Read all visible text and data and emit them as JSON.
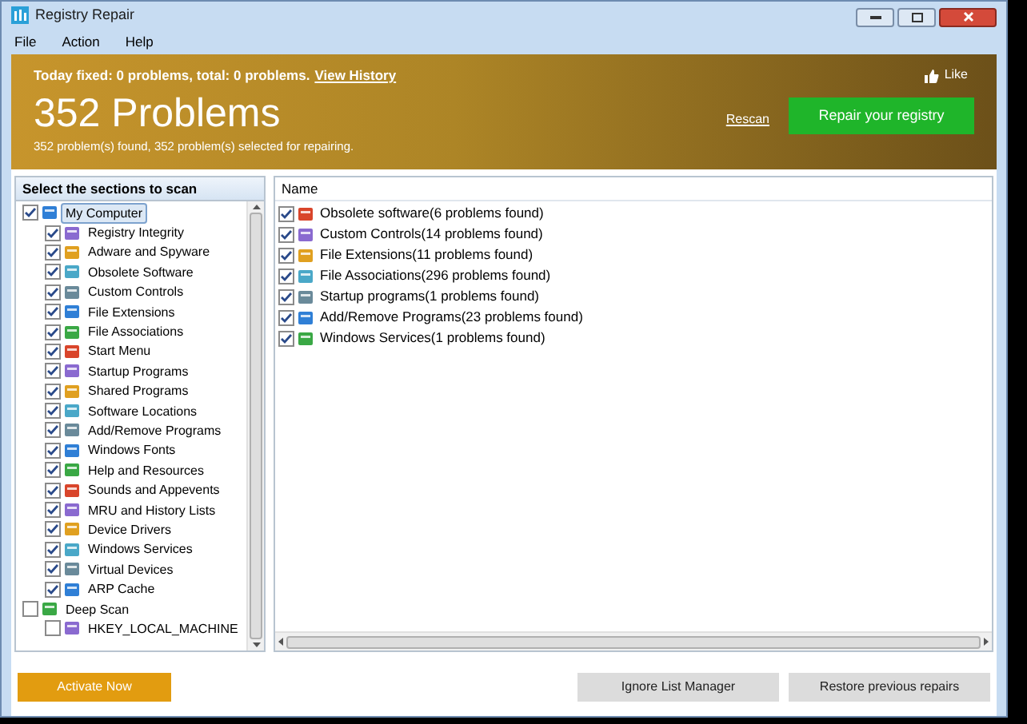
{
  "window": {
    "title": "Registry Repair"
  },
  "menu": [
    "File",
    "Action",
    "Help"
  ],
  "banner": {
    "summary": "Today fixed: 0 problems, total: 0 problems.",
    "history_link": "View History",
    "like": "Like",
    "headline": "352 Problems",
    "subline": "352 problem(s) found, 352 problem(s) selected for repairing.",
    "rescan": "Rescan",
    "repair_button": "Repair your registry"
  },
  "tree": {
    "header": "Select the sections to scan",
    "items": [
      {
        "label": "My Computer",
        "checked": true,
        "selected": true,
        "children": [
          {
            "label": "Registry Integrity",
            "checked": true,
            "selected": false
          },
          {
            "label": "Adware and Spyware",
            "checked": true,
            "selected": false
          },
          {
            "label": "Obsolete Software",
            "checked": true,
            "selected": false
          },
          {
            "label": "Custom Controls",
            "checked": true,
            "selected": false
          },
          {
            "label": "File Extensions",
            "checked": true,
            "selected": false
          },
          {
            "label": "File Associations",
            "checked": true,
            "selected": false
          },
          {
            "label": "Start Menu",
            "checked": true,
            "selected": false
          },
          {
            "label": "Startup Programs",
            "checked": true,
            "selected": false
          },
          {
            "label": "Shared Programs",
            "checked": true,
            "selected": false
          },
          {
            "label": "Software Locations",
            "checked": true,
            "selected": false
          },
          {
            "label": "Add/Remove Programs",
            "checked": true,
            "selected": false
          },
          {
            "label": "Windows Fonts",
            "checked": true,
            "selected": false
          },
          {
            "label": "Help and Resources",
            "checked": true,
            "selected": false
          },
          {
            "label": "Sounds and Appevents",
            "checked": true,
            "selected": false
          },
          {
            "label": "MRU and History Lists",
            "checked": true,
            "selected": false
          },
          {
            "label": "Device Drivers",
            "checked": true,
            "selected": false
          },
          {
            "label": "Windows Services",
            "checked": true,
            "selected": false
          },
          {
            "label": "Virtual Devices",
            "checked": true,
            "selected": false
          },
          {
            "label": "ARP Cache",
            "checked": true,
            "selected": false
          }
        ]
      },
      {
        "label": "Deep Scan",
        "checked": false,
        "selected": false,
        "children": [
          {
            "label": "HKEY_LOCAL_MACHINE",
            "checked": false,
            "selected": false
          }
        ]
      }
    ]
  },
  "results": {
    "column": "Name",
    "rows": [
      {
        "label": "Obsolete software(6 problems found)",
        "checked": true
      },
      {
        "label": "Custom Controls(14 problems found)",
        "checked": true
      },
      {
        "label": "File Extensions(11 problems found)",
        "checked": true
      },
      {
        "label": "File Associations(296 problems found)",
        "checked": true
      },
      {
        "label": "Startup programs(1 problems found)",
        "checked": true
      },
      {
        "label": "Add/Remove Programs(23 problems found)",
        "checked": true
      },
      {
        "label": "Windows Services(1 problems found)",
        "checked": true
      }
    ]
  },
  "buttons": {
    "activate": "Activate Now",
    "ignore": "Ignore List Manager",
    "restore": "Restore previous repairs"
  }
}
